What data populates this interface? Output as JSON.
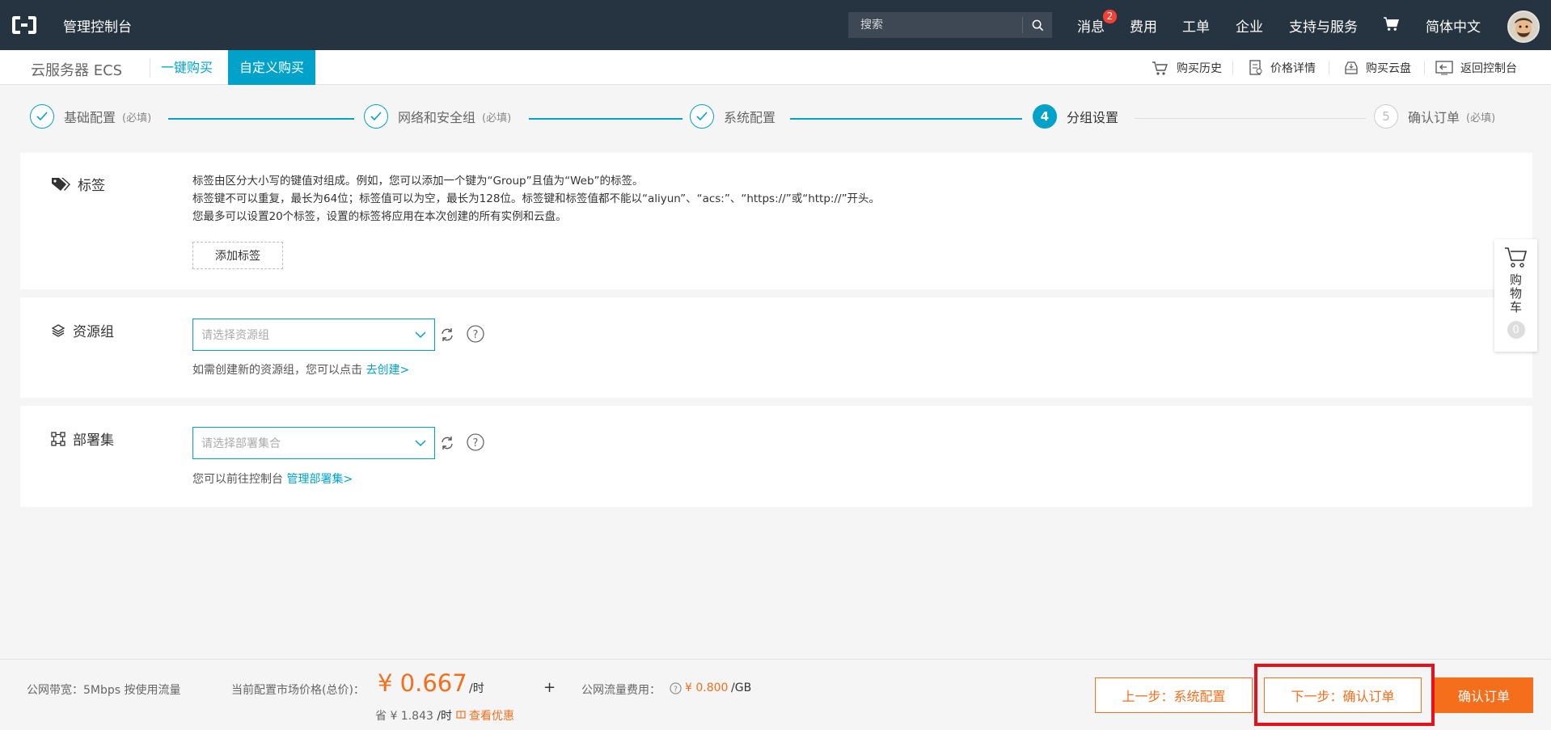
{
  "topbar": {
    "console_title": "管理控制台",
    "search_placeholder": "搜索",
    "nav": {
      "messages": "消息",
      "messages_badge": "2",
      "fees": "费用",
      "tickets": "工单",
      "enterprise": "企业",
      "support": "支持与服务",
      "language": "简体中文"
    }
  },
  "subbar": {
    "product_name": "云服务器 ECS",
    "tabs": [
      "一键购买",
      "自定义购买"
    ],
    "toolbar": [
      "购买历史",
      "价格详情",
      "购买云盘",
      "返回控制台"
    ]
  },
  "steps": [
    {
      "label": "基础配置",
      "req": "(必填)",
      "state": "done"
    },
    {
      "label": "网络和安全组",
      "req": "(必填)",
      "state": "done"
    },
    {
      "label": "系统配置",
      "req": "",
      "state": "done"
    },
    {
      "label": "分组设置",
      "req": "",
      "state": "active",
      "num": "4"
    },
    {
      "label": "确认订单",
      "req": "(必填)",
      "state": "pending",
      "num": "5"
    }
  ],
  "tags_panel": {
    "title": "标签",
    "desc_lines": [
      "标签由区分大小写的键值对组成。例如，您可以添加一个键为“Group”且值为“Web”的标签。",
      "标签键不可以重复，最长为64位；标签值可以为空，最长为128位。标签键和标签值都不能以“aliyun”、“acs:”、“https://”或“http://”开头。",
      "您最多可以设置20个标签，设置的标签将应用在本次创建的所有实例和云盘。"
    ],
    "add_button": "添加标签"
  },
  "resource_group": {
    "title": "资源组",
    "placeholder": "请选择资源组",
    "hint": "如需创建新的资源组，您可以点击",
    "hint_link": "去创建>"
  },
  "deployment_set": {
    "title": "部署集",
    "placeholder": "请选择部署集合",
    "hint": "您可以前往控制台",
    "hint_link": "管理部署集>"
  },
  "float_cart": {
    "label": "购物车",
    "count": "0"
  },
  "bottom": {
    "bandwidth": "公网带宽：5Mbps 按使用流量",
    "price_label": "当前配置市场价格(总价)：",
    "price": "¥ 0.667",
    "price_unit": "/时",
    "save_prefix": "省",
    "save_amount": "¥ 1.843",
    "save_unit": "/时",
    "view_discount": "查看优惠",
    "plus": "+",
    "traffic_label": "公网流量费用：",
    "traffic_price": "¥ 0.800",
    "traffic_unit": "/GB",
    "prev_button": "上一步：系统配置",
    "next_button": "下一步：确认订单",
    "confirm_button": "确认订单"
  },
  "colors": {
    "accent": "#00a2ca",
    "orange": "#f56e1c",
    "topbar": "#263340",
    "highlight": "#e5121c"
  }
}
